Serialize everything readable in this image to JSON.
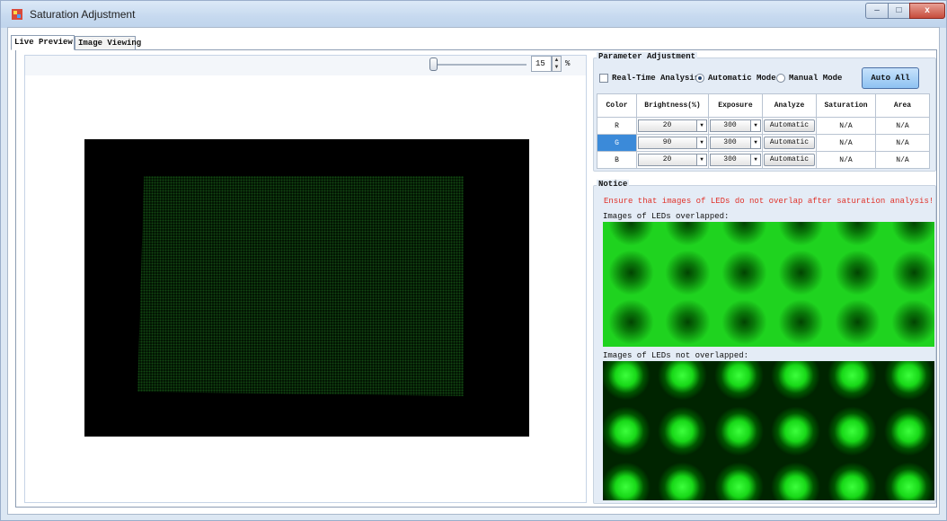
{
  "window": {
    "title": "Saturation Adjustment",
    "controls": {
      "minimize": "–",
      "maximize": "□",
      "close": "x"
    }
  },
  "tabs": [
    {
      "label": "Live Preview",
      "active": true
    },
    {
      "label": "Image Viewing",
      "active": false
    }
  ],
  "preview": {
    "zoom_value": "15",
    "zoom_unit": "%",
    "zoom_slider_fraction": 0.0
  },
  "parameter_adjustment": {
    "title": "Parameter Adjustment",
    "realtime_label": "Real-Time Analysis",
    "realtime_checked": false,
    "mode_auto_label": "Automatic Mode",
    "mode_manual_label": "Manual Mode",
    "mode_selected": "Automatic Mode",
    "auto_all_label": "Auto All",
    "columns": [
      "Color",
      "Brightness(%)",
      "Exposure",
      "Analyze",
      "Saturation",
      "Area"
    ],
    "rows": [
      {
        "color": "R",
        "brightness": "20",
        "exposure": "300",
        "analyze": "Automatic",
        "saturation": "N/A",
        "area": "N/A",
        "selected": false
      },
      {
        "color": "G",
        "brightness": "90",
        "exposure": "300",
        "analyze": "Automatic",
        "saturation": "N/A",
        "area": "N/A",
        "selected": true
      },
      {
        "color": "B",
        "brightness": "20",
        "exposure": "300",
        "analyze": "Automatic",
        "saturation": "N/A",
        "area": "N/A",
        "selected": false
      }
    ]
  },
  "notice": {
    "title": "Notice",
    "warning": "Ensure that images of LEDs do not overlap after saturation analysis!",
    "overlapped_label": "Images of LEDs overlapped:",
    "not_overlapped_label": "Images of LEDs not overlapped:"
  },
  "colors": {
    "warning_text": "#e0322a",
    "selected_cell": "#3b8ad9",
    "led_green": "#1fd31f",
    "titlebar": "#c6d9ef"
  },
  "icons": {
    "app_icon": "app-icon",
    "dropdown": "chevron-down-icon",
    "spin_up": "spin-up-icon",
    "spin_down": "spin-down-icon"
  }
}
